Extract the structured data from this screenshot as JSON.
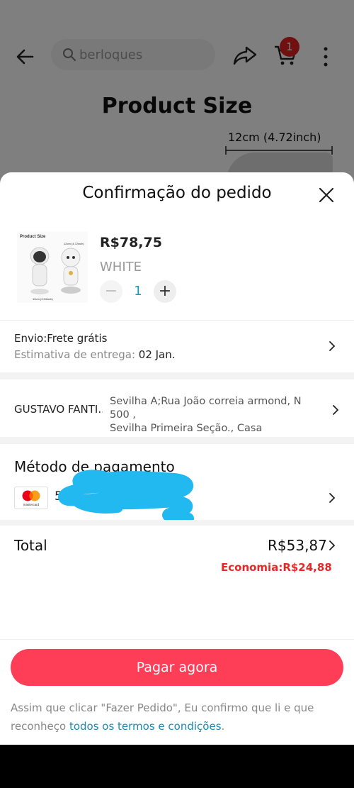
{
  "header": {
    "search_placeholder": "berloques",
    "cart_count": "1"
  },
  "background": {
    "product_size_title": "Product Size",
    "dimension_label": "12cm (4.72inch)"
  },
  "sheet": {
    "title": "Confirmação do pedido",
    "product": {
      "price": "R$78,75",
      "variant": "WHITE",
      "quantity": "1",
      "minus_label": "−",
      "plus_label": "+"
    },
    "shipping": {
      "label": "Envio:Frete grátis",
      "estimate_prefix": "Estimativa de entrega: ",
      "estimate_date": "02 Jan."
    },
    "address": {
      "name": "GUSTAVO FANTI...",
      "line1": "Sevilha A;Rua João correia armond,  N 500 ,",
      "line2": "Sevilha Primeira Seção., Casa"
    },
    "payment": {
      "title": "Método de pagamento",
      "card_brand": "mastercard",
      "card_number_visible": "5"
    },
    "total": {
      "label": "Total",
      "value": "R$53,87",
      "savings": "Economia:R$24,88"
    },
    "pay_button": "Pagar agora",
    "terms": {
      "text": "Assim que clicar \"Fazer Pedido\", Eu confirmo que li e que reconheço ",
      "link": "todos os termos e condições",
      "end": "."
    }
  },
  "colors": {
    "accent": "#fe3d57",
    "savings": "#e82828",
    "link": "#1a8bb0",
    "quantity": "#1a9ab5"
  }
}
